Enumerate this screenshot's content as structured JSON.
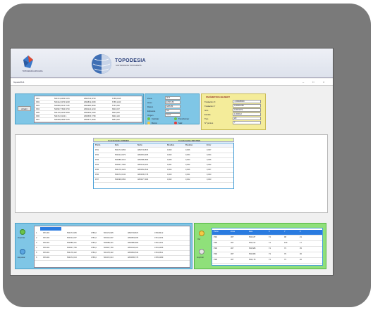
{
  "banner": {
    "brand": "TOPODESIA",
    "brand_sub": "SOFTWARE DE TOPOGRAFÍA",
    "left_caption": "TOPOGRAFÍA APLICADA"
  },
  "window": {
    "title": "TopoGPS 5",
    "min": "–",
    "max": "□",
    "close": "×"
  },
  "left_panel": {
    "button": "Añadir",
    "rows": [
      [
        "PR1",
        "563174,9350 3476",
        "4802743,8740",
        "6785,0345"
      ],
      [
        "PR2",
        "563412,0070 0248",
        "4802819,4650",
        "6785,1240"
      ],
      [
        "PR3",
        "563688,3210 7118",
        "4802980,8090",
        "6797,650"
      ],
      [
        "PR4",
        "563907,7690 0730",
        "4803144,2210",
        "6810,007"
      ],
      [
        "PR5",
        "564178,4220 5099",
        "4803352,5430",
        "6823,530"
      ],
      [
        "PR6",
        "564372,0130 1",
        "4803535,7780",
        "6834,120"
      ],
      [
        "PR7",
        "564698,0950 5155",
        "4803677,9060",
        "6851,502"
      ]
    ]
  },
  "form": {
    "labels": [
      "Zona",
      "Huso",
      "Datum",
      "Elipsoide",
      "Origen"
    ],
    "values": [
      "30 T",
      "ETRS 89",
      "GRS 80",
      "Sur",
      "Norte"
    ],
    "buttons": [
      "Calcular",
      "Transformar",
      "Borrar",
      "Salir"
    ]
  },
  "params": {
    "title": "PARÁMETROS HELMERT",
    "labels": [
      "Traslación X",
      "Traslación Y",
      "Giro",
      "Escala",
      "Tipo",
      "Nº puntos"
    ],
    "values": [
      "-1,00025849",
      "0,00001256",
      "0,0001573",
      "1,000012",
      "2D",
      "7"
    ]
  },
  "center_table": {
    "headers": [
      "Coordenadas ORIGEN",
      "Coordenadas DESTINO"
    ],
    "columns": [
      "Punto",
      "Este",
      "Norte",
      "Residuo",
      "Residuo",
      "Error"
    ],
    "rows": [
      [
        "PR1",
        "563174,9350",
        "4802743,874",
        "0,003",
        "0,006",
        "0,007"
      ],
      [
        "PR2",
        "563412,0070",
        "4802819,465",
        "0,002",
        "0,004",
        "0,004"
      ],
      [
        "PR3",
        "563688,3210",
        "4802980,809",
        "0,005",
        "0,003",
        "0,006"
      ],
      [
        "PR4",
        "563907,7690",
        "4803144,221",
        "0,001",
        "0,002",
        "0,002"
      ],
      [
        "PR5",
        "564178,4220",
        "4803352,543",
        "0,004",
        "0,006",
        "0,007"
      ],
      [
        "PR6",
        "564372,0130",
        "4803535,778",
        "0,003",
        "0,001",
        "0,003"
      ],
      [
        "PR7",
        "564698,0950",
        "4803677,906",
        "0,002",
        "0,002",
        "0,003"
      ]
    ]
  },
  "bottom_left": {
    "buttons": [
      "Importar",
      "Exportar"
    ],
    "rows": [
      [
        "1",
        "PR1-R1",
        "563174,935",
        "4780,0",
        "563174,935",
        "4802743,874",
        "4790,8412"
      ],
      [
        "2",
        "PR1-R2",
        "563412,007",
        "4781,0",
        "563412,007",
        "4802819,465",
        "4791,2234"
      ],
      [
        "3",
        "PR2-R1",
        "563688,321",
        "4782,0",
        "563688,321",
        "4802980,809",
        "4792,1122"
      ],
      [
        "4",
        "PR2-R2",
        "563907,769",
        "4783,0",
        "563907,769",
        "4803144,221",
        "4793,4056"
      ],
      [
        "5",
        "PR3-R1",
        "564178,422",
        "4784,0",
        "564178,422",
        "4803352,543",
        "4794,6611"
      ],
      [
        "6",
        "PR3-R2",
        "564372,013",
        "4785,0",
        "564372,013",
        "4803535,778",
        "4795,0089"
      ]
    ]
  },
  "bottom_right": {
    "buttons": [
      "Ver",
      "Imprimir"
    ],
    "rows": [
      [
        "Punto",
        "Zona",
        "Este",
        "X",
        "Y",
        "Z"
      ],
      [
        "PR1",
        "30T",
        "563,187",
        "74",
        "98",
        "21"
      ],
      [
        "PR2",
        "30T",
        "563,412",
        "74",
        "100",
        "17"
      ],
      [
        "PR3",
        "30T",
        "563,688",
        "74",
        "73",
        "35"
      ],
      [
        "PR4",
        "30T",
        "563,908",
        "73",
        "79",
        "36"
      ],
      [
        "PR5",
        "30T",
        "564,178",
        "74",
        "73",
        "26"
      ]
    ]
  }
}
